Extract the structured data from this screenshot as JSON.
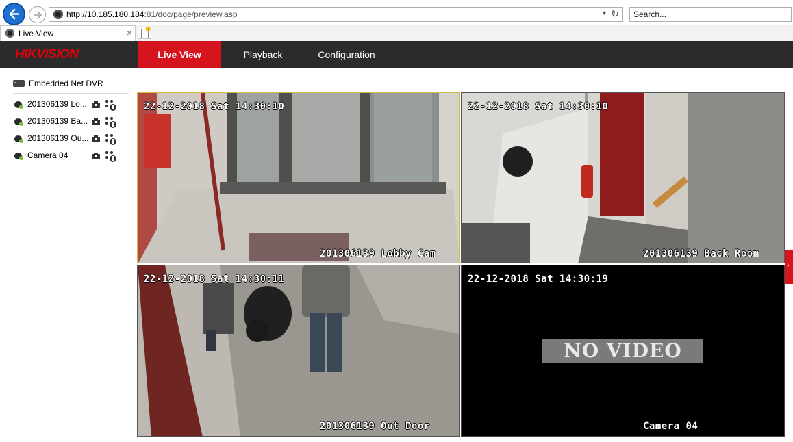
{
  "browser": {
    "url_domain": "http://10.185.180.184",
    "url_rest": ":81/doc/page/preview.asp",
    "search_placeholder": "Search...",
    "tab_title": "Live View"
  },
  "app": {
    "logo_part1": "HIK",
    "logo_part2": "VISION",
    "nav": {
      "live": "Live View",
      "playback": "Playback",
      "config": "Configuration"
    },
    "colors": {
      "accent": "#d5141e",
      "header_bg": "#2b2b2b"
    }
  },
  "devices": {
    "dvr_label": "Embedded Net DVR",
    "cameras": [
      {
        "label": "201306139 Lo..."
      },
      {
        "label": "201306139 Ba..."
      },
      {
        "label": "201306139 Ou..."
      },
      {
        "label": "Camera 04"
      }
    ]
  },
  "video": {
    "tiles": [
      {
        "timestamp": "22-12-2018 Sat 14:30:10",
        "name": "201306139 Lobby Cam"
      },
      {
        "timestamp": "22-12-2018 Sat 14:30:10",
        "name": "201306139 Back Room"
      },
      {
        "timestamp": "22-12-2018 Sat 14:30:11",
        "name": "201306139 Out Door"
      },
      {
        "timestamp": "22-12-2018 Sat 14:30:19",
        "name": "Camera 04",
        "status": "NO VIDEO"
      }
    ]
  }
}
